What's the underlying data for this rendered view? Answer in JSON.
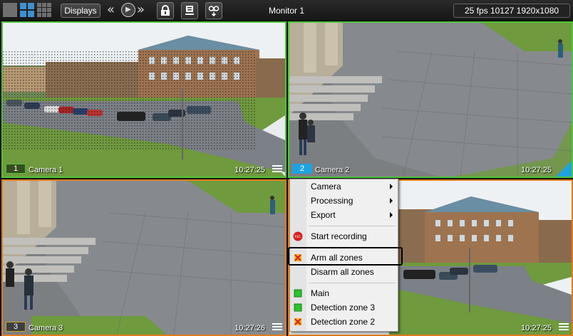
{
  "toolbar": {
    "displays_label": "Displays",
    "monitor_title": "Monitor 1",
    "stats": "25 fps  10127 1920x1080",
    "prev_glyph": "«",
    "play_glyph": "▶",
    "next_glyph": "»",
    "icons": [
      "layout-single-icon",
      "layout-2x2-icon",
      "layout-3x3-icon",
      "lock-icon",
      "eject-icon",
      "tape-icon"
    ]
  },
  "cameras": [
    {
      "num": "1",
      "name": "Camera 1",
      "time": "10:27:25"
    },
    {
      "num": "2",
      "name": "Camera 2",
      "time": "10:27:25"
    },
    {
      "num": "3",
      "name": "Camera 3",
      "time": "10:27:26"
    },
    {
      "num": "",
      "name": "",
      "time": "10:27:25"
    }
  ],
  "context_menu": {
    "items": [
      {
        "label": "Camera",
        "submenu": true
      },
      {
        "label": "Processing",
        "submenu": true
      },
      {
        "label": "Export",
        "submenu": true
      },
      {
        "label": "Start recording",
        "icon": "rec-icon"
      },
      {
        "label": "Arm all zones",
        "icon": "arm-zone-icon"
      },
      {
        "label": "Disarm all zones"
      },
      {
        "label": "Main",
        "icon": "green-zone-icon"
      },
      {
        "label": "Detection zone 3",
        "icon": "green-zone-icon"
      },
      {
        "label": "Detection zone 2",
        "icon": "arm-zone-icon"
      }
    ],
    "rec_text": "REC",
    "highlighted": "Arm all zones"
  },
  "colors": {
    "active_border": "#4fc43a",
    "alarm_border": "#e07b1e",
    "selected_badge": "#1fa3e0"
  }
}
